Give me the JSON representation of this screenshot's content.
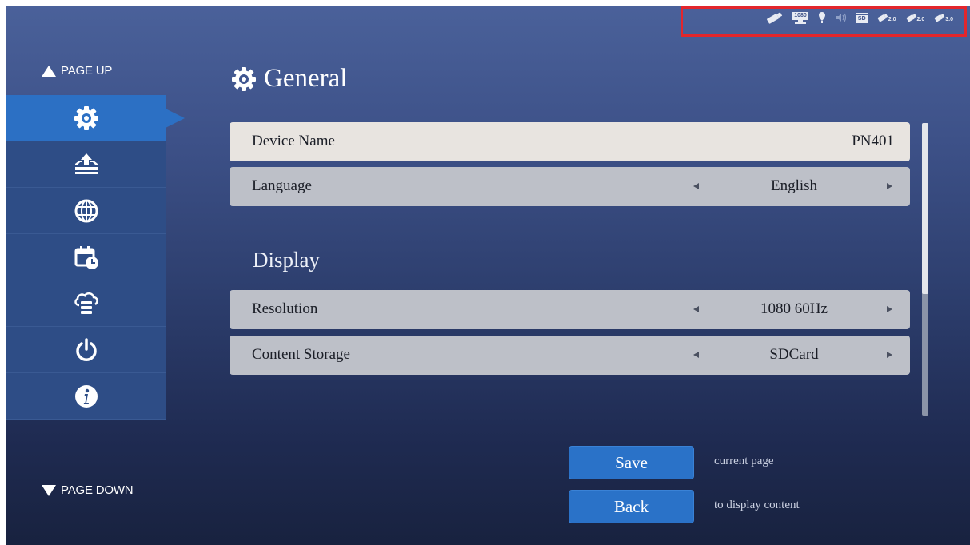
{
  "status_bar": {
    "icons": [
      "usb-icon",
      "hdmi-1080-icon",
      "location-pin-icon",
      "volume-icon",
      "sd-card-icon",
      "usb-2-0-icon",
      "usb-2-0-icon",
      "usb-3-0-icon"
    ],
    "hdmi_label": "1080",
    "sd_label": "SD",
    "usb_labels": [
      "2.0",
      "2.0",
      "3.0"
    ],
    "highlight_color": "#e3262c"
  },
  "sidebar": {
    "page_up": "PAGE UP",
    "page_down": "PAGE DOWN",
    "items": [
      {
        "icon": "gear-icon",
        "active": true
      },
      {
        "icon": "inbox-upload-icon",
        "active": false
      },
      {
        "icon": "globe-network-icon",
        "active": false
      },
      {
        "icon": "calendar-clock-icon",
        "active": false
      },
      {
        "icon": "cloud-server-icon",
        "active": false
      },
      {
        "icon": "power-icon",
        "active": false
      },
      {
        "icon": "info-icon",
        "active": false
      }
    ]
  },
  "main": {
    "title": "General",
    "rows": {
      "device_name": {
        "label": "Device Name",
        "value": "PN401"
      },
      "language": {
        "label": "Language",
        "value": "English"
      }
    },
    "display_section": {
      "heading": "Display",
      "resolution": {
        "label": "Resolution",
        "value": "1080 60Hz"
      },
      "content_storage": {
        "label": "Content Storage",
        "value": "SDCard"
      }
    }
  },
  "actions": {
    "save": {
      "label": "Save",
      "hint": "current page"
    },
    "back": {
      "label": "Back",
      "hint": "to display content"
    }
  },
  "colors": {
    "accent": "#2c70c4",
    "button": "#2a72c8",
    "row": "#bdc0c8",
    "row_selected": "#e8e4e0"
  }
}
